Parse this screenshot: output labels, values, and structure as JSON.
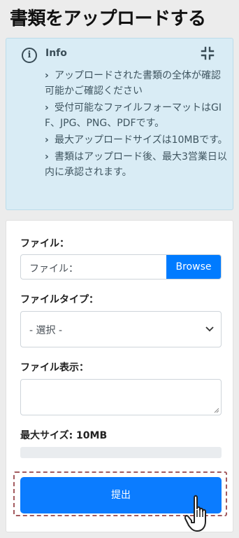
{
  "page": {
    "title": "書類をアップロードする"
  },
  "info": {
    "title": "Info",
    "items": [
      "アップロードされた書類の全体が確認可能かご確認ください",
      "受付可能なファイルフォーマットはGIF、JPG、PNG、PDFです。",
      "最大アップロードサイズは10MBです。",
      "書類はアップロード後、最大3営業日以内に承認されます。"
    ]
  },
  "form": {
    "file_label": "ファイル：",
    "file_placeholder": "ファイル：",
    "browse_label": "Browse",
    "type_label": "ファイルタイプ：",
    "type_selected": "- 選択 -",
    "display_label": "ファイル表示：",
    "max_size_label": "最大サイズ: 10MB",
    "upload_progress": 0,
    "submit_label": "提出"
  },
  "colors": {
    "primary": "#007bff",
    "info_bg": "#d9ecf5",
    "highlight_outline": "#a35a5e"
  },
  "icons": [
    "info-icon",
    "collapse-icon",
    "chevron-right-icon",
    "chevron-down-icon",
    "cursor-icon"
  ]
}
